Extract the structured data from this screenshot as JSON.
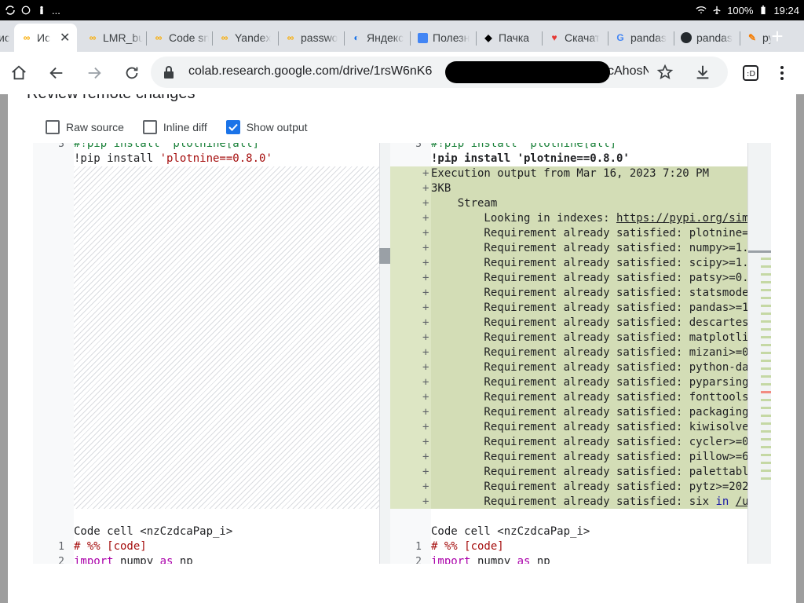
{
  "statusbar": {
    "left_icons": [
      "sync-icon",
      "whatsapp-icon",
      "person-icon",
      "more-dots"
    ],
    "more_label": "...",
    "battery": "100%",
    "time": "19:24"
  },
  "tabs": [
    {
      "title": "Ис",
      "favicon": "colab-icon",
      "active": true
    },
    {
      "title": "LMR_bu",
      "favicon": "colab-icon"
    },
    {
      "title": "Code sn",
      "favicon": "colab-icon"
    },
    {
      "title": "Yandex",
      "favicon": "colab-icon"
    },
    {
      "title": "passwo",
      "favicon": "colab-icon"
    },
    {
      "title": "Яндекс",
      "favicon": "edge-icon"
    },
    {
      "title": "Полезн",
      "favicon": "blue-square-icon"
    },
    {
      "title": "Пачка",
      "favicon": "pachka-icon"
    },
    {
      "title": "Скачат",
      "favicon": "heart-icon"
    },
    {
      "title": "pandas",
      "favicon": "google-icon"
    },
    {
      "title": "pandas",
      "favicon": "github-icon"
    },
    {
      "title": "py",
      "favicon": "pen-icon"
    }
  ],
  "toolbar": {
    "url_visible_start": "colab.research.google.com/drive/1rsW6nK6",
    "url_visible_end": "cAhosN?hl="
  },
  "dialog": {
    "title": "Review remote changes",
    "options": [
      {
        "label": "Raw source",
        "checked": false
      },
      {
        "label": "Inline diff",
        "checked": false
      },
      {
        "label": "Show output",
        "checked": true
      }
    ]
  },
  "diff": {
    "left": {
      "top_line_num": "3",
      "top_line_text": "#!pip install 'plotnine[all]'",
      "install_prefix": "!pip install ",
      "install_arg": "'plotnine==0.8.0'",
      "cell_header": "Code cell <nzCzdcaPap_i>",
      "line1_num": "1",
      "line1_text": "# %% [code]",
      "line2_num": "2",
      "line2_import": "import",
      "line2_mid": " numpy ",
      "line2_as": "as",
      "line2_end": " np"
    },
    "right": {
      "top_line_num": "3",
      "top_line_text": "#!pip install 'plotnine[all]'",
      "install_line": "!pip install 'plotnine==0.8.0'",
      "output_lines": [
        "Execution output from Mar 16, 2023 7:20 PM",
        "3KB",
        "    Stream",
        "        Looking in indexes: ",
        "        Requirement already satisfied: plotnine=",
        "        Requirement already satisfied: numpy>=1.",
        "        Requirement already satisfied: scipy>=1.",
        "        Requirement already satisfied: patsy>=0.",
        "        Requirement already satisfied: statsmode",
        "        Requirement already satisfied: pandas>=1",
        "        Requirement already satisfied: descartes",
        "        Requirement already satisfied: matplotli",
        "        Requirement already satisfied: mizani>=0",
        "        Requirement already satisfied: python-da",
        "        Requirement already satisfied: pyparsing",
        "        Requirement already satisfied: fonttools",
        "        Requirement already satisfied: packaging",
        "        Requirement already satisfied: kiwisolve",
        "        Requirement already satisfied: cycler>=0",
        "        Requirement already satisfied: pillow>=6",
        "        Requirement already satisfied: palettabl",
        "        Requirement already satisfied: pytz>=202",
        "        Requirement already satisfied: six "
      ],
      "index_link": "https://pypi.org/sim",
      "six_in": "in",
      "six_path": "/u",
      "cell_header": "Code cell <nzCzdcaPap_i>",
      "line1_num": "1",
      "line1_text": "# %% [code]",
      "line2_num": "2",
      "line2_import": "import",
      "line2_mid": " numpy ",
      "line2_as": "as",
      "line2_end": " np"
    }
  },
  "colors": {
    "added_bg": "#d3ddb6",
    "accent": "#1a73e8",
    "comment_green": "#188038",
    "string_red": "#a50e0e",
    "keyword_purple": "#aa00aa"
  }
}
